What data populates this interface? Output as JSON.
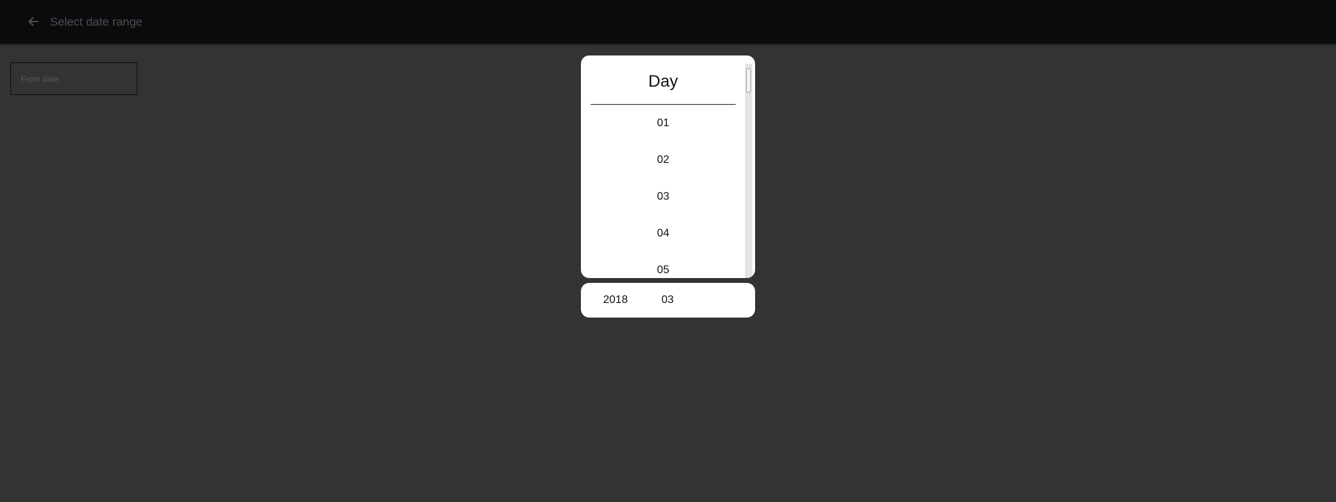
{
  "header": {
    "title": "Select date range",
    "back_icon": "arrow-left-icon"
  },
  "from_date": {
    "placeholder": "From date",
    "value": ""
  },
  "day_picker": {
    "title": "Day",
    "items": [
      "01",
      "02",
      "03",
      "04",
      "05"
    ]
  },
  "selection": {
    "year": "2018",
    "month": "03"
  },
  "colors": {
    "topbar": "#0a0b0d",
    "background": "#333333",
    "panel": "#ffffff"
  }
}
